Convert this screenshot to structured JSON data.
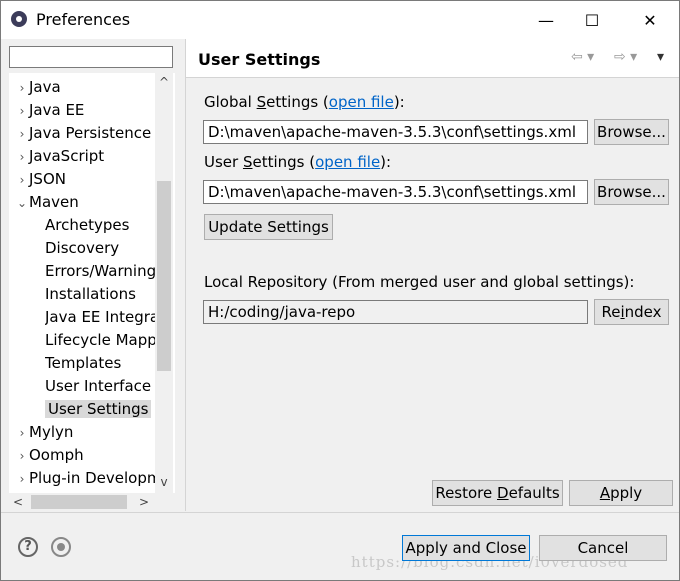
{
  "window": {
    "title": "Preferences",
    "minimize": "—",
    "maximize": "☐",
    "close": "✕"
  },
  "filter": {
    "value": ""
  },
  "tree": [
    {
      "label": "Java",
      "arrow": "›",
      "indent": 0,
      "selected": false
    },
    {
      "label": "Java EE",
      "arrow": "›",
      "indent": 0,
      "selected": false
    },
    {
      "label": "Java Persistence",
      "arrow": "›",
      "indent": 0,
      "selected": false
    },
    {
      "label": "JavaScript",
      "arrow": "›",
      "indent": 0,
      "selected": false
    },
    {
      "label": "JSON",
      "arrow": "›",
      "indent": 0,
      "selected": false
    },
    {
      "label": "Maven",
      "arrow": "⌄",
      "indent": 0,
      "selected": false
    },
    {
      "label": "Archetypes",
      "arrow": "",
      "indent": 1,
      "selected": false
    },
    {
      "label": "Discovery",
      "arrow": "",
      "indent": 1,
      "selected": false
    },
    {
      "label": "Errors/Warnings",
      "arrow": "",
      "indent": 1,
      "selected": false
    },
    {
      "label": "Installations",
      "arrow": "",
      "indent": 1,
      "selected": false
    },
    {
      "label": "Java EE Integration",
      "arrow": "",
      "indent": 1,
      "selected": false
    },
    {
      "label": "Lifecycle Mappings",
      "arrow": "",
      "indent": 1,
      "selected": false
    },
    {
      "label": "Templates",
      "arrow": "",
      "indent": 1,
      "selected": false
    },
    {
      "label": "User Interface",
      "arrow": "",
      "indent": 1,
      "selected": false
    },
    {
      "label": "User Settings",
      "arrow": "",
      "indent": 1,
      "selected": true
    },
    {
      "label": "Mylyn",
      "arrow": "›",
      "indent": 0,
      "selected": false
    },
    {
      "label": "Oomph",
      "arrow": "›",
      "indent": 0,
      "selected": false
    },
    {
      "label": "Plug-in Development",
      "arrow": "›",
      "indent": 0,
      "selected": false
    }
  ],
  "scroll": {
    "up": "^",
    "down": "v",
    "left": "<",
    "right": ">"
  },
  "page": {
    "title": "User Settings",
    "nav_back": "⇦ ▾",
    "nav_forward": "⇨ ▾",
    "nav_menu": "▾",
    "global_label_a": "Global ",
    "global_label_u": "S",
    "global_label_b": "ettings (",
    "global_link": "open file",
    "global_label_c": "):",
    "global_value": "D:\\maven\\apache-maven-3.5.3\\conf\\settings.xml",
    "browse1": "Browse...",
    "user_label_a": "User ",
    "user_label_u": "S",
    "user_label_b": "ettings (",
    "user_link": "open file",
    "user_label_c": "):",
    "user_value": "D:\\maven\\apache-maven-3.5.3\\conf\\settings.xml",
    "browse2": "Browse...",
    "update_settings": "Update Settings",
    "local_repo_label": "Local Repository (From merged user and global settings):",
    "local_repo_value": "H:/coding/java-repo",
    "reindex_a": "Re",
    "reindex_u": "i",
    "reindex_b": "ndex",
    "restore_a": "Restore ",
    "restore_u": "D",
    "restore_b": "efaults",
    "apply_u": "A",
    "apply_b": "pply"
  },
  "footer": {
    "help": "?",
    "apply_close": "Apply and Close",
    "cancel": "Cancel",
    "watermark": "https://blog.csdn.net/i0verdosed"
  }
}
